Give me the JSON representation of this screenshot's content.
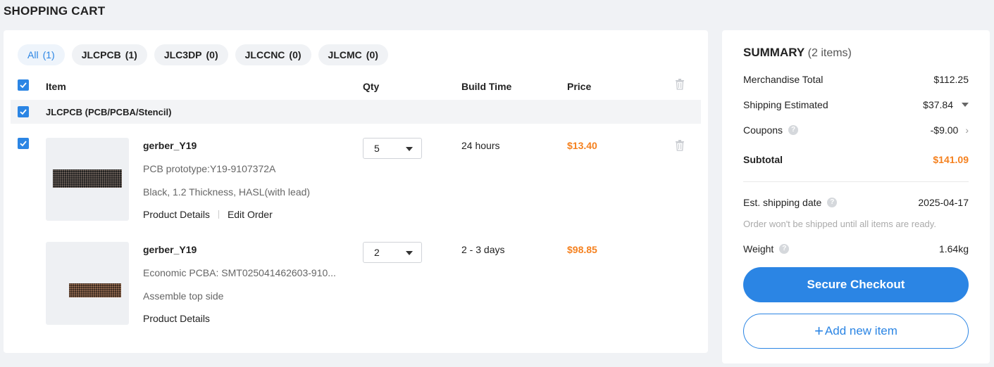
{
  "page": {
    "title": "SHOPPING CART"
  },
  "tabs": [
    {
      "label": "All",
      "count": "(1)"
    },
    {
      "label": "JLCPCB",
      "count": "(1)"
    },
    {
      "label": "JLC3DP",
      "count": "(0)"
    },
    {
      "label": "JLCCNC",
      "count": "(0)"
    },
    {
      "label": "JLCMC",
      "count": "(0)"
    }
  ],
  "table": {
    "headers": {
      "item": "Item",
      "qty": "Qty",
      "build_time": "Build Time",
      "price": "Price"
    },
    "group_label": "JLCPCB (PCB/PCBA/Stencil)"
  },
  "items": [
    {
      "name": "gerber_Y19",
      "line1": "PCB prototype:Y19-9107372A",
      "line2": "Black, 1.2 Thickness, HASL(with lead)",
      "link1": "Product Details",
      "link2": "Edit Order",
      "qty": "5",
      "build_time": "24 hours",
      "price": "$13.40"
    },
    {
      "name": "gerber_Y19",
      "line1": "Economic PCBA: SMT025041462603-910...",
      "line2": "Assemble top side",
      "link1": "Product Details",
      "qty": "2",
      "build_time": "2 - 3 days",
      "price": "$98.85"
    }
  ],
  "summary": {
    "title": "SUMMARY",
    "items_count": "(2 items)",
    "merchandise_label": "Merchandise Total",
    "merchandise_value": "$112.25",
    "shipping_label": "Shipping Estimated",
    "shipping_value": "$37.84",
    "coupons_label": "Coupons",
    "coupons_value": "-$9.00",
    "subtotal_label": "Subtotal",
    "subtotal_value": "$141.09",
    "ship_date_label": "Est. shipping date",
    "ship_date_value": "2025-04-17",
    "ship_note": "Order won't be shipped until all items are ready.",
    "weight_label": "Weight",
    "weight_value": "1.64kg",
    "checkout_label": "Secure Checkout",
    "add_item_label": "Add new item"
  },
  "colors": {
    "accent": "#2b85e4",
    "price": "#f5811f"
  },
  "icons": [
    "checkbox-checked-icon",
    "trash-icon",
    "question-icon",
    "caret-down-icon",
    "chevron-right-icon",
    "plus-icon"
  ]
}
